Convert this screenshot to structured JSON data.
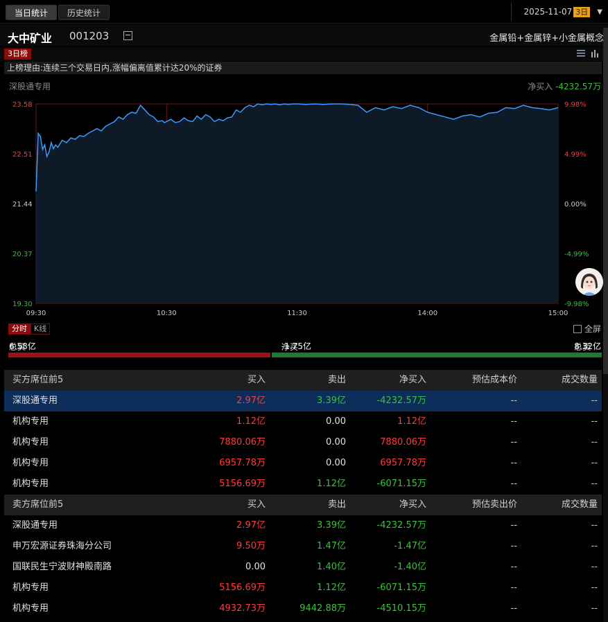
{
  "tabs": {
    "today": "当日统计",
    "history": "历史统计"
  },
  "date": {
    "value": "2025-11-07",
    "badge": "3日"
  },
  "stock": {
    "name": "大中矿业",
    "code": "001203",
    "concepts": "金属铅+金属锌+小金属概念"
  },
  "list_tag": "3日榜",
  "reason": "上榜理由:连续三个交易日内,涨幅偏离值累计达20%的证券",
  "chart_header": {
    "seat": "深股通专用",
    "net_label": "净买入",
    "net_value": "-4232.57万"
  },
  "chart_tabs": {
    "intraday": "分时",
    "kline": "K线"
  },
  "fullscreen": "全屏",
  "totals": {
    "buy_label": "总买",
    "buy_value": "6.58亿",
    "net_label": "净买",
    "net_value": "-1.75亿",
    "sell_label": "总卖",
    "sell_value": "8.32亿",
    "buy_amount": 6.58,
    "sell_amount": 8.32
  },
  "colors": {
    "up": "#ff3b3b",
    "down": "#3bc13b",
    "line": "#3d9bff",
    "accent": "#e8a21a"
  },
  "buy_table": {
    "headers": [
      "买方席位前5",
      "买入",
      "卖出",
      "净买入",
      "预估成本价",
      "成交数量"
    ],
    "rows": [
      [
        "深股通专用",
        "2.97亿",
        "3.39亿",
        "-4232.57万",
        "--",
        "--"
      ],
      [
        "机构专用",
        "1.12亿",
        "0.00",
        "1.12亿",
        "--",
        "--"
      ],
      [
        "机构专用",
        "7880.06万",
        "0.00",
        "7880.06万",
        "--",
        "--"
      ],
      [
        "机构专用",
        "6957.78万",
        "0.00",
        "6957.78万",
        "--",
        "--"
      ],
      [
        "机构专用",
        "5156.69万",
        "1.12亿",
        "-6071.15万",
        "--",
        "--"
      ]
    ]
  },
  "sell_table": {
    "headers": [
      "卖方席位前5",
      "买入",
      "卖出",
      "净买入",
      "预估卖出价",
      "成交数量"
    ],
    "rows": [
      [
        "深股通专用",
        "2.97亿",
        "3.39亿",
        "-4232.57万",
        "--",
        "--"
      ],
      [
        "申万宏源证券珠海分公司",
        "9.50万",
        "1.47亿",
        "-1.47亿",
        "--",
        "--"
      ],
      [
        "国联民生宁波财神殿南路",
        "0.00",
        "1.40亿",
        "-1.40亿",
        "--",
        "--"
      ],
      [
        "机构专用",
        "5156.69万",
        "1.12亿",
        "-6071.15万",
        "--",
        "--"
      ],
      [
        "机构专用",
        "4932.73万",
        "9442.88万",
        "-4510.15万",
        "--",
        "--"
      ]
    ]
  },
  "chart_data": {
    "type": "line",
    "title": "",
    "y_ticks": [
      "23.58",
      "22.51",
      "21.44",
      "20.37",
      "19.30"
    ],
    "pct_ticks": [
      "9.98%",
      "4.99%",
      "0.00%",
      "-4.99%",
      "-9.98%"
    ],
    "x_ticks": [
      "09:30",
      "10:30",
      "11:30",
      "14:00",
      "15:00"
    ],
    "ylim": [
      19.3,
      23.58
    ],
    "prev_close": 21.44,
    "x_minutes": [
      0,
      1,
      2,
      3,
      4,
      5,
      6,
      7,
      8,
      9,
      10,
      12,
      14,
      16,
      18,
      20,
      22,
      24,
      26,
      28,
      30,
      32,
      34,
      36,
      38,
      40,
      42,
      44,
      46,
      48,
      50,
      52,
      54,
      56,
      58,
      59,
      60,
      62,
      64,
      66,
      68,
      70,
      72,
      74,
      76,
      78,
      80,
      82,
      84,
      86,
      88,
      90,
      92,
      94,
      96,
      98,
      100,
      102,
      104,
      106,
      108,
      110,
      112,
      114,
      116,
      118,
      120,
      124,
      128,
      132,
      136,
      140,
      144,
      148,
      152,
      156,
      160,
      164,
      168,
      172,
      176,
      180,
      184,
      188,
      192,
      196,
      200,
      204,
      208,
      212,
      216,
      220,
      224,
      228,
      232,
      236,
      240
    ],
    "values": [
      21.7,
      22.95,
      22.88,
      22.6,
      22.7,
      22.45,
      22.55,
      22.75,
      22.62,
      22.7,
      22.65,
      22.8,
      22.75,
      22.85,
      22.82,
      22.9,
      22.88,
      22.95,
      23.0,
      23.05,
      23.0,
      23.1,
      23.15,
      23.2,
      23.3,
      23.25,
      23.35,
      23.4,
      23.38,
      23.55,
      23.45,
      23.35,
      23.3,
      23.2,
      23.22,
      23.18,
      23.2,
      23.25,
      23.18,
      23.2,
      23.28,
      23.22,
      23.2,
      23.32,
      23.25,
      23.35,
      23.3,
      23.2,
      23.25,
      23.22,
      23.28,
      23.3,
      23.45,
      23.4,
      23.5,
      23.55,
      23.52,
      23.58,
      23.56,
      23.58,
      23.57,
      23.58,
      23.56,
      23.58,
      23.57,
      23.58,
      23.58,
      23.57,
      23.58,
      23.57,
      23.58,
      23.58,
      23.57,
      23.55,
      23.4,
      23.5,
      23.45,
      23.52,
      23.48,
      23.55,
      23.5,
      23.4,
      23.35,
      23.3,
      23.25,
      23.32,
      23.35,
      23.3,
      23.38,
      23.4,
      23.5,
      23.48,
      23.55,
      23.5,
      23.48,
      23.45,
      23.5
    ]
  }
}
